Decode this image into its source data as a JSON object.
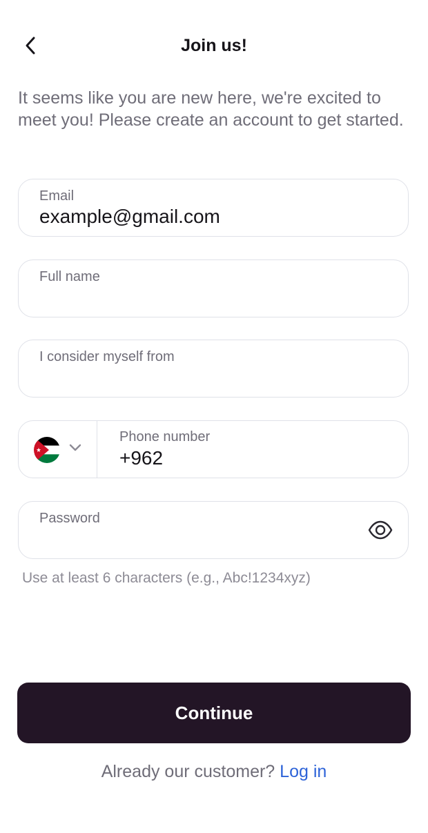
{
  "header": {
    "title": "Join us!",
    "back_icon": "chevron-left-icon"
  },
  "intro": "It seems like you are new here, we're excited to meet you! Please create an account to get started.",
  "form": {
    "email": {
      "label": "Email",
      "value": "example@gmail.com"
    },
    "full_name": {
      "label": "Full name",
      "value": ""
    },
    "origin": {
      "label": "I consider myself from",
      "value": ""
    },
    "phone": {
      "country_flag": "jordan-flag",
      "label": "Phone number",
      "value": "+962"
    },
    "password": {
      "label": "Password",
      "value": "",
      "toggle_icon": "eye-icon",
      "hint": "Use at least 6 characters (e.g., Abc!1234xyz)"
    }
  },
  "actions": {
    "continue_label": "Continue",
    "login_prompt": "Already our customer?",
    "login_link": "Log in"
  },
  "colors": {
    "primary_button": "#231526",
    "link": "#2d63d8",
    "muted_text": "#6f6d78",
    "field_border": "#dfe1e8"
  }
}
